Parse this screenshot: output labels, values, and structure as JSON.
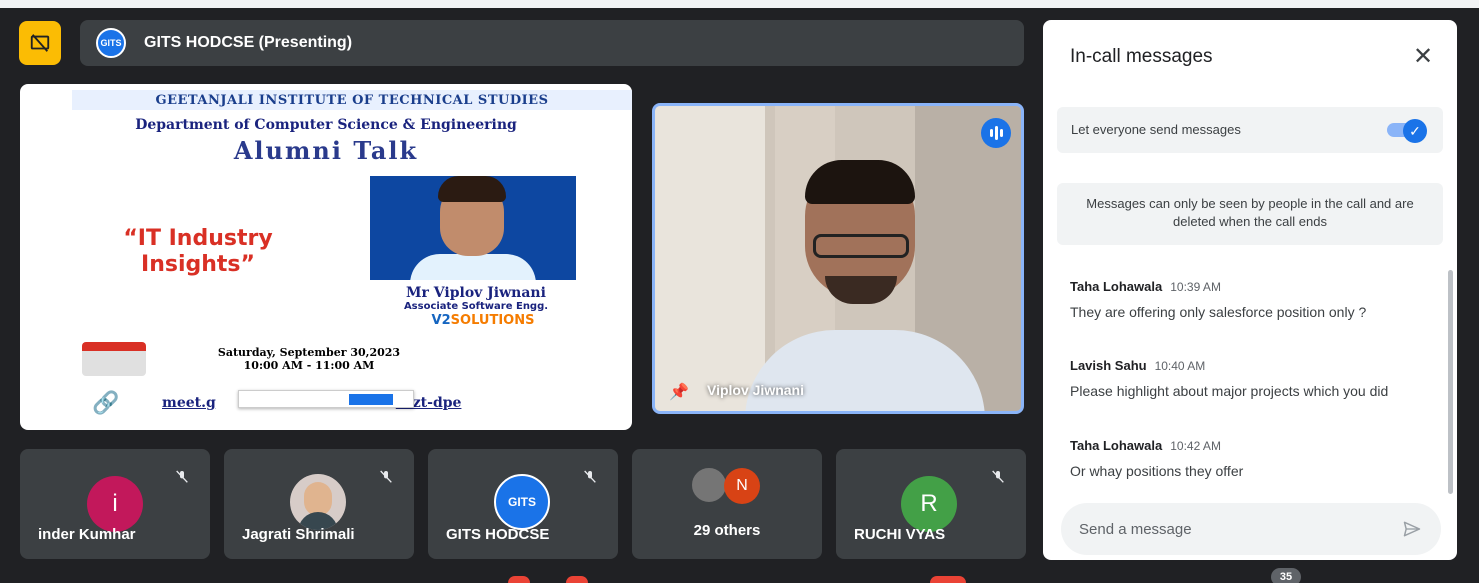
{
  "presentation": {
    "presenter_label": "GITS HODCSE (Presenting)",
    "logo_text": "GITS"
  },
  "poster": {
    "institute": "GEETANJALI INSTITUTE OF TECHNICAL STUDIES",
    "department": "Department of Computer Science & Engineering",
    "event": "Alumni Talk",
    "topic": "“IT Industry Insights”",
    "speaker": "Mr Viplov Jiwnani",
    "role": "Associate Software Engg.",
    "company_prefix": "V2",
    "company_suffix": "SOLUTIONS",
    "date": "Saturday, September 30,2023",
    "time": "10:00 AM - 11:00 AM",
    "link_start": "meet.g",
    "link_end": "sazt-dpe"
  },
  "video_tile": {
    "name": "Viplov Jiwnani"
  },
  "participants": [
    {
      "name": "inder Kumhar",
      "initial": "i",
      "color": "#c2185b"
    },
    {
      "name": "Jagrati Shrimali"
    },
    {
      "name": "GITS HODCSE",
      "logo_text": "GITS"
    },
    {
      "name": "29 others",
      "initial": "N",
      "color": "#d84315"
    },
    {
      "name": "RUCHI VYAS",
      "initial": "R",
      "color": "#43a047"
    }
  ],
  "chat": {
    "title": "In-call messages",
    "toggle_label": "Let everyone send messages",
    "toggle_on": true,
    "notice": "Messages can only be seen by people in the call and are deleted when the call ends",
    "messages": [
      {
        "sender": "Taha Lohawala",
        "time": "10:39 AM",
        "text": "They are offering only salesforce position only ?"
      },
      {
        "sender": "Lavish Sahu",
        "time": "10:40 AM",
        "text": "Please highlight about major projects which you did"
      },
      {
        "sender": "Taha Lohawala",
        "time": "10:42 AM",
        "text": "Or whay positions they offer"
      }
    ],
    "input_placeholder": "Send a message"
  },
  "participant_count": "35"
}
